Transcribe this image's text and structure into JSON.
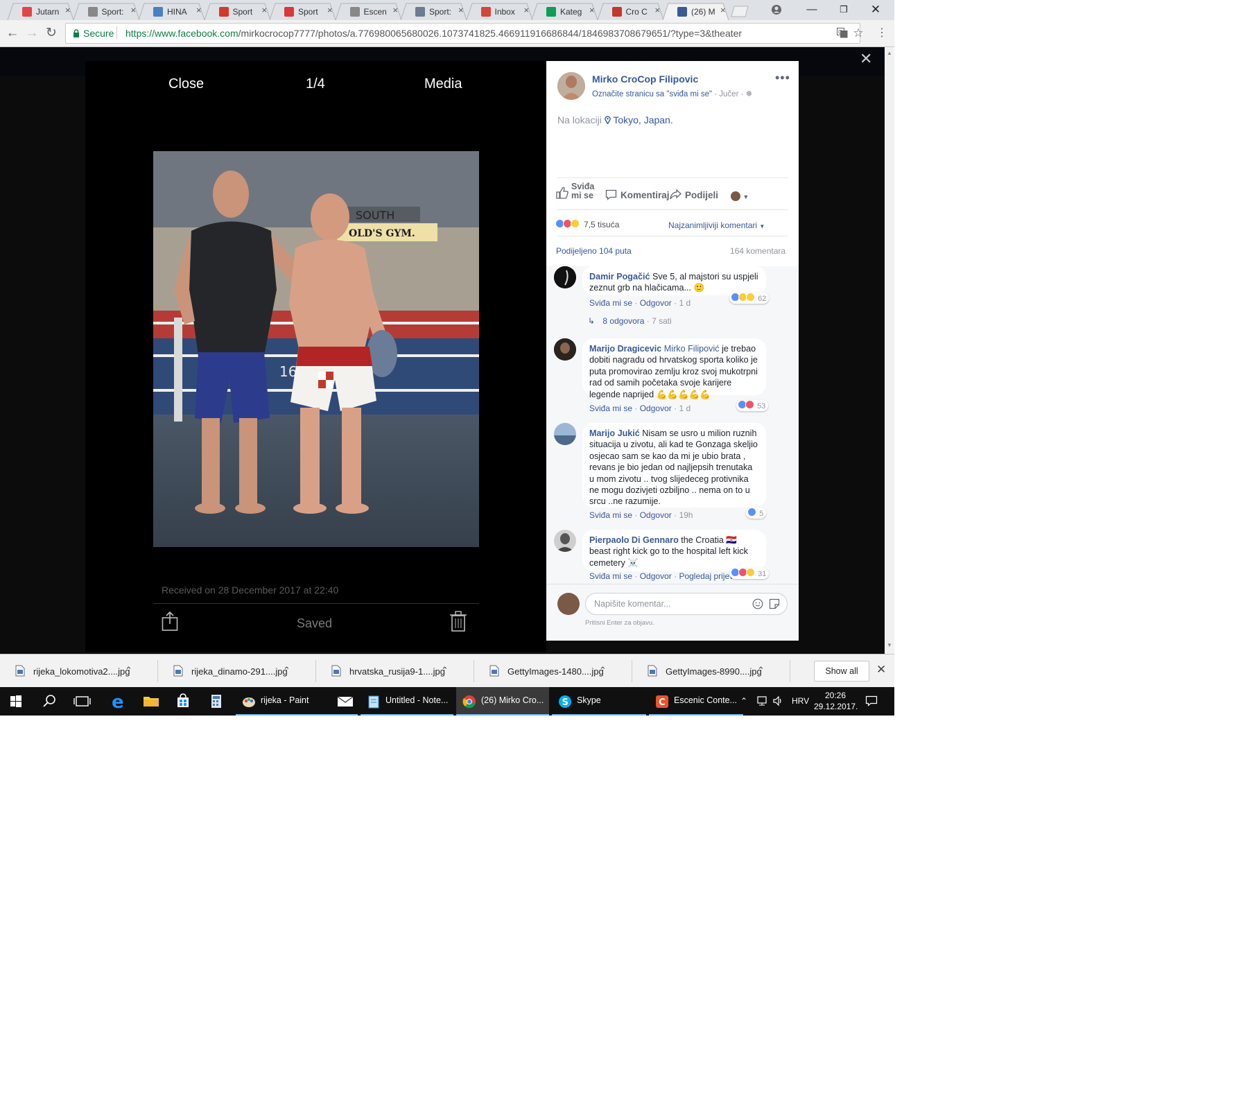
{
  "browser": {
    "tabs": [
      {
        "title": "Jutarn",
        "favicon_color": "#e04646"
      },
      {
        "title": "Sport:",
        "favicon_color": "#888888"
      },
      {
        "title": "HINA",
        "favicon_color": "#4a7fc1"
      },
      {
        "title": "Sport",
        "favicon_color": "#d33a2c"
      },
      {
        "title": "Sport",
        "favicon_color": "#d9383a"
      },
      {
        "title": "Escen",
        "favicon_color": "#888888"
      },
      {
        "title": "Sport:",
        "favicon_color": "#6b7c93"
      },
      {
        "title": "Inbox",
        "favicon_color": "#d44638"
      },
      {
        "title": "Kateg",
        "favicon_color": "#0f9d58"
      },
      {
        "title": "Cro C",
        "favicon_color": "#c0392b"
      },
      {
        "title": "(26) M",
        "favicon_color": "#3b5998"
      }
    ],
    "secure_label": "Secure",
    "url_host": "https://www.facebook.com",
    "url_path": "/mirkocrocop7777/photos/a.776980065680026.1073741825.466911916686844/1846983708679651/?type=3&theater"
  },
  "viewer": {
    "close_label": "Close",
    "counter": "1/4",
    "media_label": "Media",
    "received": "Received on 28 December 2017 at 22:40",
    "saved_label": "Saved",
    "photo_sign": "SOUTH",
    "photo_gym": "OLD'S GYM."
  },
  "post": {
    "author": "Mirko CroCop Filipovic",
    "like_page": "Označite stranicu sa \"sviđa mi se\"",
    "time": "· Jučer ·",
    "location_prefix": "Na lokaciji",
    "location": "Tokyo, Japan.",
    "actions": {
      "like": "Sviđa mi se",
      "comment": "Komentiraj",
      "share": "Podijeli"
    },
    "reactions_count": "7,5 tisuća",
    "sort_label": "Najzanimljiviji komentari",
    "shared": "Podijeljeno 104 puta",
    "comments_count": "164 komentara"
  },
  "comments": [
    {
      "name": "Damir Pogačić",
      "text": "Sve 5, al majstori su uspjeli zeznut grb na hlačicama... 🙂",
      "meta": "1 d",
      "reactions": "62",
      "replies": "8 odgovora",
      "replies_time": "· 7 sati"
    },
    {
      "name": "Marijo Dragicevic",
      "mention": "Mirko Filipović",
      "text": "je trebao dobiti nagradu od hrvatskog sporta koliko je puta promovirao zemlju kroz svoj mukotrpni rad od samih početaka svoje karijere legende naprijed 💪💪💪💪💪",
      "meta": "1 d",
      "reactions": "53"
    },
    {
      "name": "Marijo Jukić",
      "text": "Nisam se usro u milion ruznih situacija u zivotu, ali kad te Gonzaga skeljio osjecao sam se kao da mi je ubio brata , revans je bio jedan od najljepsih trenutaka u mom zivotu .. tvog slijedeceg protivnika ne mogu dozivjeti ozbiljno .. nema on to u srcu ..ne razumije.",
      "meta": "19h",
      "reactions": "5"
    },
    {
      "name": "Pierpaolo Di Gennaro",
      "text": "the Croatia 🇭🇷 beast right kick go to the hospital left kick cemetery ☠️",
      "see_translation": "Pogledaj prijevod",
      "reactions": "31"
    }
  ],
  "comment_actions": {
    "like": "Sviđa mi se",
    "reply": "Odgovor",
    "dot": "·"
  },
  "composer": {
    "placeholder": "Napišite komentar...",
    "hint": "Pritisni Enter za objavu."
  },
  "downloads": {
    "files": [
      "rijeka_lokomotiva2....jpg",
      "rijeka_dinamo-291....jpg",
      "hrvatska_rusija9-1....jpg",
      "GettyImages-1480....jpg",
      "GettyImages-8990....jpg"
    ],
    "show_all": "Show all"
  },
  "taskbar": {
    "apps": [
      {
        "label": "rijeka - Paint",
        "icon": "paint-icon"
      },
      {
        "label": "Untitled - Note...",
        "icon": "notepad-icon"
      },
      {
        "label": "(26) Mirko Cro...",
        "icon": "chrome-icon"
      },
      {
        "label": "Skype",
        "icon": "skype-icon"
      },
      {
        "label": "Escenic Conte...",
        "icon": "escenic-icon"
      }
    ],
    "lang": "HRV",
    "time": "20:26",
    "date": "29.12.2017."
  },
  "colors": {
    "fb_blue": "#365899",
    "fb_header": "#27355a",
    "secure_green": "#0b8043",
    "taskbar": "#101010",
    "accent": "#76b9ed"
  }
}
